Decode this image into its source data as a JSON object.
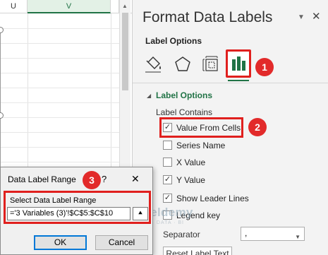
{
  "sheet": {
    "columns": [
      "U",
      "V"
    ]
  },
  "pane": {
    "title": "Format Data Labels",
    "dropdown_icon": "chevron-down-icon",
    "close_icon": "close-icon",
    "subtitle": "Label Options",
    "tabs": [
      {
        "name": "fill-line",
        "icon": "paint-bucket-icon"
      },
      {
        "name": "effects",
        "icon": "pentagon-icon"
      },
      {
        "name": "size-properties",
        "icon": "size-properties-icon"
      },
      {
        "name": "label-options",
        "icon": "bar-chart-icon",
        "active": true
      }
    ],
    "section_title": "Label Options",
    "group_label": "Label Contains",
    "options": [
      {
        "label": "Value From Cells",
        "checked": true
      },
      {
        "label": "Series Name",
        "checked": false
      },
      {
        "label": "X Value",
        "checked": false
      },
      {
        "label": "Y Value",
        "checked": true
      },
      {
        "label": "Show Leader Lines",
        "checked": true
      },
      {
        "label": "Legend key",
        "checked": false
      }
    ],
    "separator_label": "Separator",
    "separator_value": ",",
    "reset_label": "Reset Label Text"
  },
  "badges": [
    "1",
    "2",
    "3"
  ],
  "watermark": {
    "name": "exceldemy",
    "tagline": "EXCEL · DATA · BI"
  },
  "dialog": {
    "title": "Data Label Range",
    "help": "?",
    "close": "✕",
    "field_label": "Select Data Label Range",
    "field_value": "='3 Variables (3)'!$C$5:$C$10",
    "ok_label": "OK",
    "cancel_label": "Cancel"
  },
  "colors": {
    "accent_green": "#217346",
    "highlight_red": "#e0201e",
    "badge_red": "#e22a2a"
  }
}
